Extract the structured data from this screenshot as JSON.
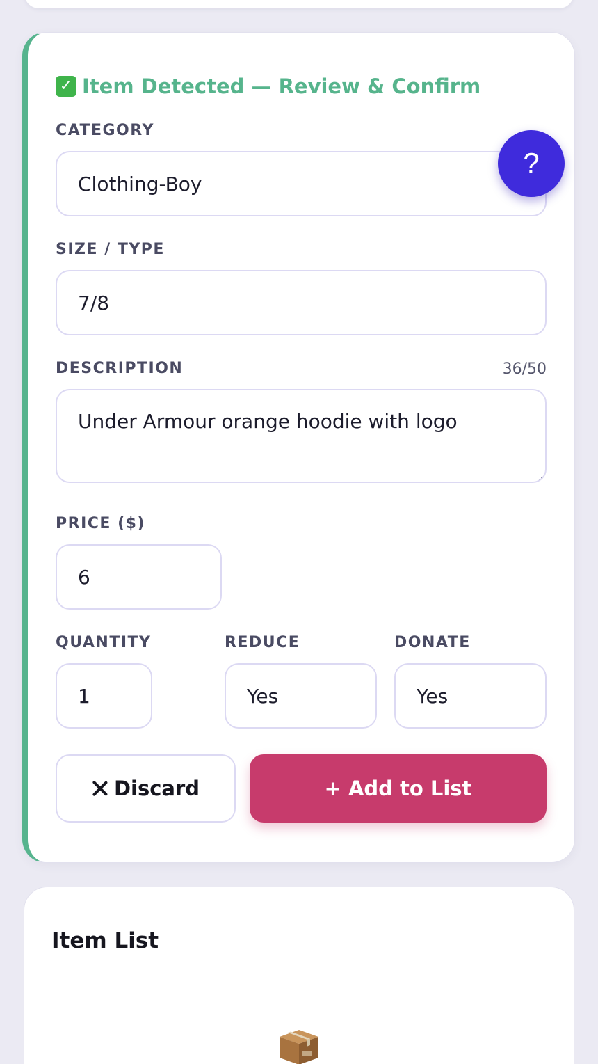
{
  "review": {
    "title": "Item Detected — Review & Confirm",
    "accent_color": "#56b48c",
    "check_icon": "check-mark-button-icon"
  },
  "fields": {
    "category": {
      "label": "CATEGORY",
      "value": "Clothing-Boy"
    },
    "size": {
      "label": "SIZE / TYPE",
      "value": "7/8"
    },
    "description": {
      "label": "DESCRIPTION",
      "value": "Under Armour orange hoodie with logo",
      "char_count": "36/50"
    },
    "price": {
      "label": "PRICE ($)",
      "value": "6"
    },
    "quantity": {
      "label": "QUANTITY",
      "value": "1"
    },
    "reduce": {
      "label": "REDUCE",
      "value": "Yes"
    },
    "donate": {
      "label": "DONATE",
      "value": "Yes"
    }
  },
  "help": {
    "label": "?",
    "color": "#3f2bdc"
  },
  "actions": {
    "discard_label": "Discard",
    "add_label": "+ Add to List",
    "add_color": "#c73b6c"
  },
  "item_list": {
    "title": "Item List",
    "empty_icon": "package-box-icon"
  }
}
